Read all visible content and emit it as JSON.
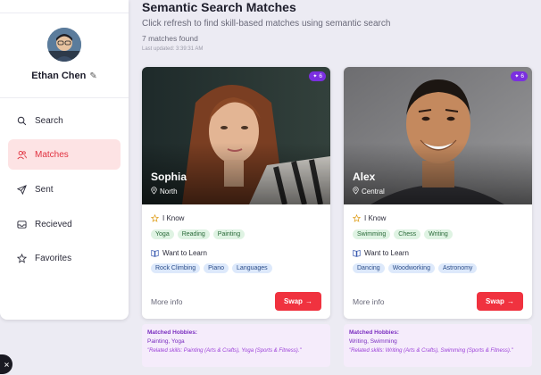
{
  "profile": {
    "name": "Ethan Chen"
  },
  "nav": [
    {
      "label": "Search",
      "icon": "search-icon",
      "active": false
    },
    {
      "label": "Matches",
      "icon": "users-icon",
      "active": true
    },
    {
      "label": "Sent",
      "icon": "send-icon",
      "active": false
    },
    {
      "label": "Recieved",
      "icon": "inbox-icon",
      "active": false
    },
    {
      "label": "Favorites",
      "icon": "star-icon",
      "active": false
    }
  ],
  "header": {
    "title": "Semantic Search Matches",
    "subtitle": "Click refresh to find skill-based matches using semantic search",
    "count": "7 matches found",
    "updated": "Last updated: 3:39:31 AM"
  },
  "cards": [
    {
      "name": "Sophia",
      "location": "North",
      "badge": "6",
      "know_label": "I Know",
      "know": [
        "Yoga",
        "Reading",
        "Painting"
      ],
      "learn_label": "Want to Learn",
      "learn": [
        "Rock Climbing",
        "Piano",
        "Languages"
      ],
      "more": "More info",
      "swap": "Swap",
      "matched_heading": "Matched Hobbies:",
      "matched_values": "Painting, Yoga",
      "matched_related": "\"Related skills: Painting (Arts & Crafts), Yoga (Sports & Fitness).\""
    },
    {
      "name": "Alex",
      "location": "Central",
      "badge": "6",
      "know_label": "I Know",
      "know": [
        "Swimming",
        "Chess",
        "Writing"
      ],
      "learn_label": "Want to Learn",
      "learn": [
        "Dancing",
        "Woodworking",
        "Astronomy"
      ],
      "more": "More info",
      "swap": "Swap",
      "matched_heading": "Matched Hobbies:",
      "matched_values": "Writing, Swimming",
      "matched_related": "\"Related skills: Writing (Arts & Crafts), Swimming (Sports & Fitness).\""
    }
  ],
  "colors": {
    "accent": "#f0323f",
    "badge": "#7b2fe0",
    "matched_text": "#7b2fc0"
  }
}
